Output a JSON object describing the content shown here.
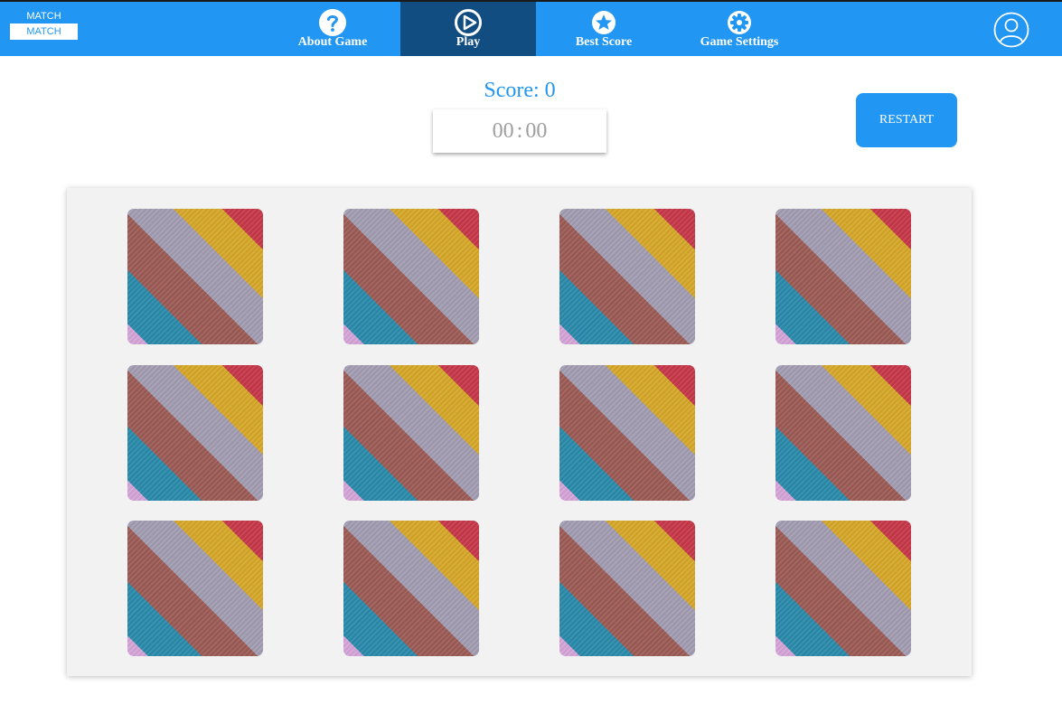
{
  "logo": {
    "top": "MATCH",
    "bottom": "MATCH"
  },
  "nav": {
    "items": [
      {
        "label": "About Game",
        "icon": "question-circle-icon"
      },
      {
        "label": "Play",
        "icon": "play-circle-icon",
        "active": true
      },
      {
        "label": "Best Score",
        "icon": "star-circle-icon"
      },
      {
        "label": "Game Settings",
        "icon": "gear-circle-icon"
      }
    ],
    "user_icon": "user-circle-icon"
  },
  "score": {
    "label": "Score:",
    "value": "0"
  },
  "timer": {
    "minutes": "00",
    "separator": ":",
    "seconds": "00"
  },
  "restart_label": "RESTART",
  "board": {
    "rows": 3,
    "columns": 4,
    "cards": [
      {
        "state": "face-down"
      },
      {
        "state": "face-down"
      },
      {
        "state": "face-down"
      },
      {
        "state": "face-down"
      },
      {
        "state": "face-down"
      },
      {
        "state": "face-down"
      },
      {
        "state": "face-down"
      },
      {
        "state": "face-down"
      },
      {
        "state": "face-down"
      },
      {
        "state": "face-down"
      },
      {
        "state": "face-down"
      },
      {
        "state": "face-down"
      }
    ]
  },
  "colors": {
    "primary": "#2196f3",
    "nav_active": "#114d80",
    "board_bg": "#f2f2f2",
    "timer_text": "#9e9e9e",
    "card_stripes": [
      "#c8384a",
      "#d8a929",
      "#a49eb4",
      "#9e5c56",
      "#2a8cac",
      "#d7a6da"
    ]
  }
}
